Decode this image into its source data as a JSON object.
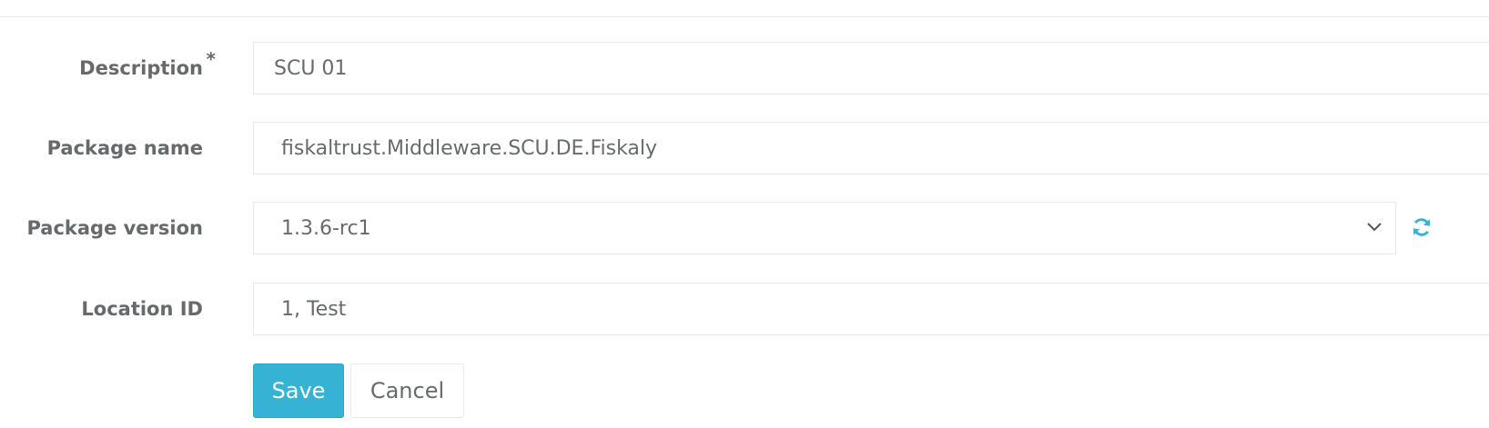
{
  "form": {
    "description": {
      "label": "Description",
      "required_mark": "*",
      "value": "SCU 01"
    },
    "package_name": {
      "label": "Package name",
      "value": "fiskaltrust.Middleware.SCU.DE.Fiskaly"
    },
    "package_version": {
      "label": "Package version",
      "value": "1.3.6-rc1",
      "refresh_icon": "refresh-icon"
    },
    "location_id": {
      "label": "Location ID",
      "value": "1, Test"
    }
  },
  "actions": {
    "save_label": "Save",
    "cancel_label": "Cancel"
  },
  "colors": {
    "accent": "#36b2d5",
    "label_text": "#676a6c",
    "border": "#e5e6e7"
  }
}
